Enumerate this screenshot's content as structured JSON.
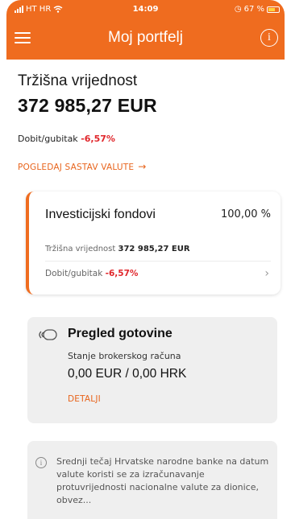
{
  "status_bar": {
    "carrier": "HT HR",
    "time": "14:09",
    "battery": "67 %"
  },
  "header": {
    "title": "Moj portfelj",
    "info_symbol": "i"
  },
  "summary": {
    "market_value_label": "Tržišna vrijednost",
    "market_value": "372 985,27 EUR",
    "profit_loss_label": "Dobit/gubitak",
    "profit_loss_value": "-6,57%",
    "view_currency_link": "POGLEDAJ SASTAV VALUTE",
    "link_arrow": "→"
  },
  "fund_card": {
    "title": "Investicijski fondovi",
    "percentage": "100,00 %",
    "market_value_label": "Tržišna vrijednost",
    "market_value": "372 985,27 EUR",
    "profit_loss_label": "Dobit/gubitak",
    "profit_loss_value": "-6,57%",
    "chevron": "›"
  },
  "cash_card": {
    "title": "Pregled gotovine",
    "subtitle": "Stanje brokerskog računa",
    "value": "0,00 EUR / 0,00 HRK",
    "details_link": "DETALJI"
  },
  "info_card": {
    "symbol": "i",
    "text": "Srednji tečaj Hrvatske narodne banke na datum valute koristi se za izračunavanje protuvrijednosti nacionalne valute za dionice, obvez..."
  },
  "colors": {
    "accent": "#ef6c1f",
    "negative": "#e0262b",
    "card_gray": "#efefef"
  },
  "icons": [
    "wifi-icon",
    "alarm-icon",
    "battery-icon",
    "menu-icon",
    "info-icon",
    "arrow-right-icon",
    "chevron-right-icon",
    "cash-icon"
  ]
}
